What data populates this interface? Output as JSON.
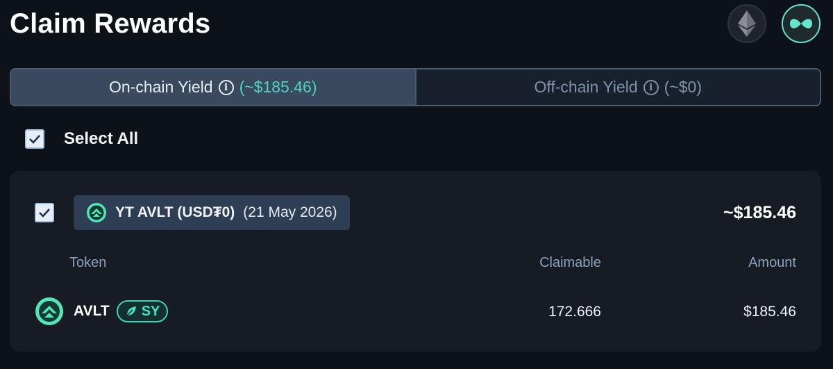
{
  "header": {
    "title": "Claim Rewards",
    "network_icons": [
      "ethereum-icon",
      "pendle-network-icon"
    ]
  },
  "tabs": [
    {
      "label": "On-chain Yield",
      "amount": "~$185.46",
      "active": true
    },
    {
      "label": "Off-chain Yield",
      "amount": "~$0",
      "active": false
    }
  ],
  "select_all": {
    "label": "Select All",
    "checked": true
  },
  "pools": [
    {
      "name": "YT AVLT (USD₮0)",
      "date": "(21 May 2026)",
      "total": "~$185.46",
      "checked": true,
      "columns": {
        "token": "Token",
        "claimable": "Claimable",
        "amount": "Amount"
      },
      "rows": [
        {
          "token": "AVLT",
          "badge": "SY",
          "claimable": "172.666",
          "amount": "$185.46"
        }
      ]
    }
  ],
  "colors": {
    "background": "#0d1118",
    "accent": "#4fd3c1",
    "card": "#171c24",
    "tab_active": "#3a4a5e"
  }
}
